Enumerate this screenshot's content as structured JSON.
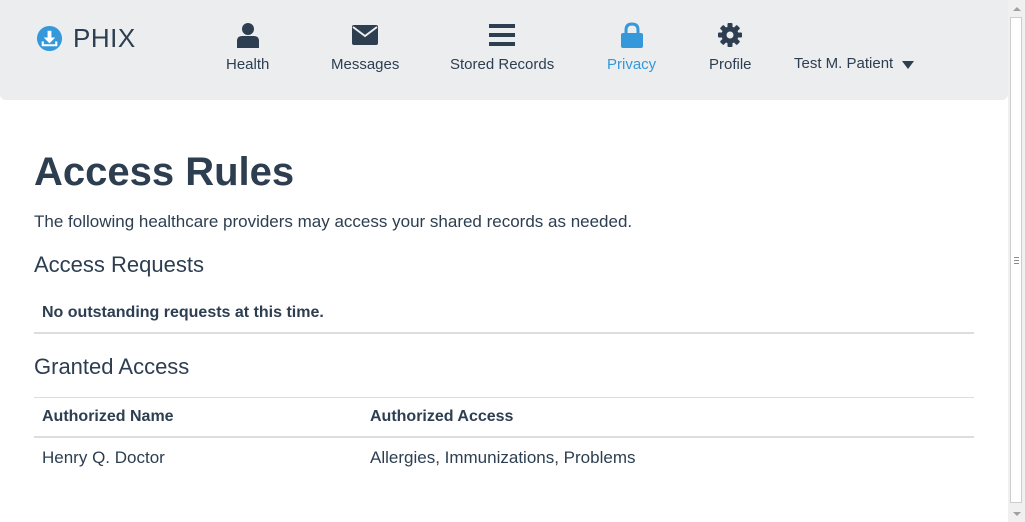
{
  "brand": {
    "name": "PHIX",
    "icon": "download-circle-icon"
  },
  "nav": {
    "items": [
      {
        "label": "Health",
        "icon": "user-icon",
        "active": false
      },
      {
        "label": "Messages",
        "icon": "envelope-icon",
        "active": false
      },
      {
        "label": "Stored Records",
        "icon": "list-icon",
        "active": false
      },
      {
        "label": "Privacy",
        "icon": "lock-icon",
        "active": true
      },
      {
        "label": "Profile",
        "icon": "gear-icon",
        "active": false
      }
    ],
    "user": "Test M. Patient"
  },
  "colors": {
    "navbar_bg": "#ecedee",
    "text": "#2c3e50",
    "accent": "#3498db"
  },
  "page": {
    "title": "Access Rules",
    "intro": "The following healthcare providers may access your shared records as needed.",
    "requests_heading": "Access Requests",
    "no_requests": "No outstanding requests at this time.",
    "granted_heading": "Granted Access",
    "table": {
      "headers": [
        "Authorized Name",
        "Authorized Access"
      ],
      "rows": [
        [
          "Henry Q. Doctor",
          "Allergies, Immunizations, Problems"
        ]
      ]
    }
  }
}
